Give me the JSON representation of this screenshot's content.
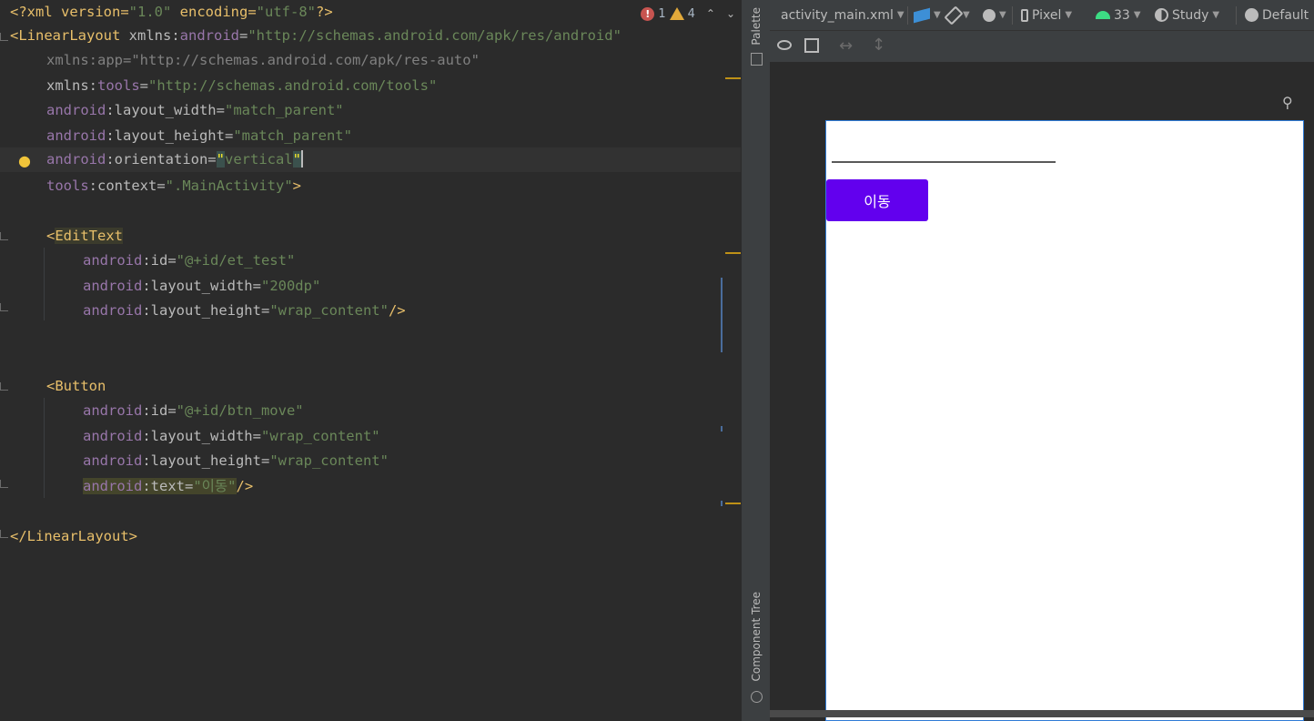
{
  "editor": {
    "status": {
      "errors": "1",
      "warnings": "4"
    },
    "lines": {
      "l1": {
        "a": "<?xml version=",
        "b": "\"1.0\"",
        "c": " encoding=",
        "d": "\"utf-8\"",
        "e": "?>"
      },
      "l2": {
        "a": "<LinearLayout ",
        "b": "xmlns:",
        "c": "android",
        "d": "=",
        "e": "\"http://schemas.android.com/apk/res/android\""
      },
      "l3": {
        "a": "xmlns:app=",
        "b": "\"http://schemas.android.com/apk/res-auto\""
      },
      "l4": {
        "a": "xmlns:",
        "b": "tools",
        "c": "=",
        "d": "\"http://schemas.android.com/tools\""
      },
      "l5": {
        "a": "android",
        "b": ":layout_width=",
        "c": "\"match_parent\""
      },
      "l6": {
        "a": "android",
        "b": ":layout_height=",
        "c": "\"match_parent\""
      },
      "l7": {
        "a": "android",
        "b": ":orientation=",
        "c": "\"",
        "d": "vertical",
        "e": "\""
      },
      "l8": {
        "a": "tools",
        "b": ":context=",
        "c": "\".MainActivity\"",
        "d": ">"
      },
      "l10": {
        "a": "<",
        "b": "EditText"
      },
      "l11": {
        "a": "android",
        "b": ":id=",
        "c": "\"@+id/et_test\""
      },
      "l12": {
        "a": "android",
        "b": ":layout_width=",
        "c": "\"200dp\""
      },
      "l13": {
        "a": "android",
        "b": ":layout_height=",
        "c": "\"wrap_content\"",
        "d": "/>"
      },
      "l16": {
        "a": "<Button"
      },
      "l17": {
        "a": "android",
        "b": ":id=",
        "c": "\"@+id/btn_move\""
      },
      "l18": {
        "a": "android",
        "b": ":layout_width=",
        "c": "\"wrap_content\""
      },
      "l19": {
        "a": "android",
        "b": ":layout_height=",
        "c": "\"wrap_content\""
      },
      "l20": {
        "a": "android",
        "b": ":text=",
        "c": "\"이동\"",
        "d": "/>"
      },
      "l22": {
        "a": "</LinearLayout>"
      }
    }
  },
  "strip": {
    "palette": "Palette",
    "component_tree": "Component Tree"
  },
  "designer": {
    "toolbar": {
      "file": "activity_main.xml",
      "device": "Pixel",
      "api": "33",
      "theme": "Study",
      "locale": "Default"
    },
    "preview": {
      "button_text": "이동"
    }
  },
  "colors": {
    "button": "#6200ee",
    "editor_bg": "#2b2b2b",
    "panel_bg": "#3c3f41",
    "xml_tag": "#e8bf6a",
    "ns": "#9876aa",
    "string": "#6a8759"
  }
}
